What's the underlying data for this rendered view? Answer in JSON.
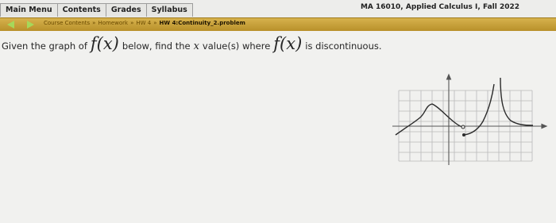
{
  "tabs": [
    {
      "label": "Main Menu"
    },
    {
      "label": "Contents"
    },
    {
      "label": "Grades"
    },
    {
      "label": "Syllabus"
    }
  ],
  "course_title": "MA 16010, Applied Calculus I, Fall 2022",
  "breadcrumb": {
    "items": [
      "Course Contents",
      "Homework",
      "HW 4"
    ],
    "separator": "»",
    "current": "HW 4:Continuity_2.problem"
  },
  "question": {
    "prefix": "Given the graph of",
    "func": "f(x)",
    "middle_a": "below, find the",
    "var": "x",
    "middle_b": "value(s) where",
    "suffix": "is discontinuous."
  },
  "icons": {
    "back": "back-arrow-icon",
    "forward": "forward-arrow-icon"
  },
  "colors": {
    "navbar": "#c9a23c",
    "arrows": "#a6d85a",
    "curve": "#2b2b2b"
  }
}
